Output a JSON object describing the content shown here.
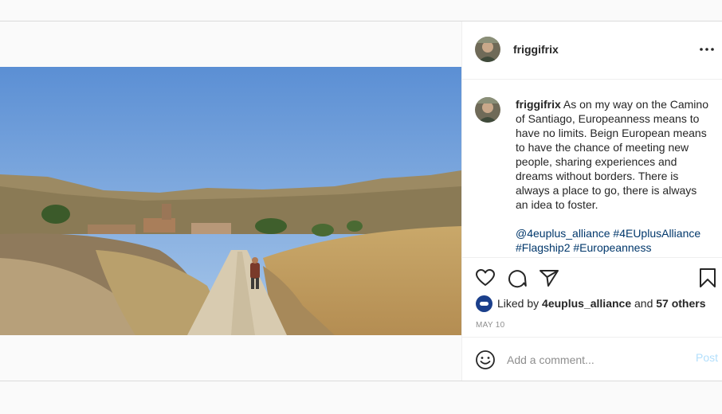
{
  "post": {
    "username": "friggifrix",
    "more_icon": "more-horizontal-icon",
    "image_alt_icon": "landscape-photo",
    "caption_text": "As on my way on the Camino of Santiago, Europeanness means to have no limits. Beign European means to have the chance of meeting new people, sharing experiences and dreams without borders. There is always a place to go, there is always an idea to foster.",
    "hashtags": "@4euplus_alliance #4EUplusAlliance #Flagship2 #Europeanness",
    "liked_by_prefix": "Liked by",
    "liked_by_user": "4euplus_alliance",
    "liked_by_and": "and",
    "liked_by_others": "57 others",
    "date": "MAY 10"
  },
  "actions": {
    "icons": [
      "heart-icon",
      "comment-icon",
      "share-icon",
      "bookmark-icon"
    ]
  },
  "comment_box": {
    "placeholder": "Add a comment...",
    "post_label": "Post"
  },
  "colors": {
    "hashtag": "#00376b",
    "post_disabled": "#b2dffc",
    "muted": "#8e8e8e",
    "border": "#dbdbdb"
  }
}
